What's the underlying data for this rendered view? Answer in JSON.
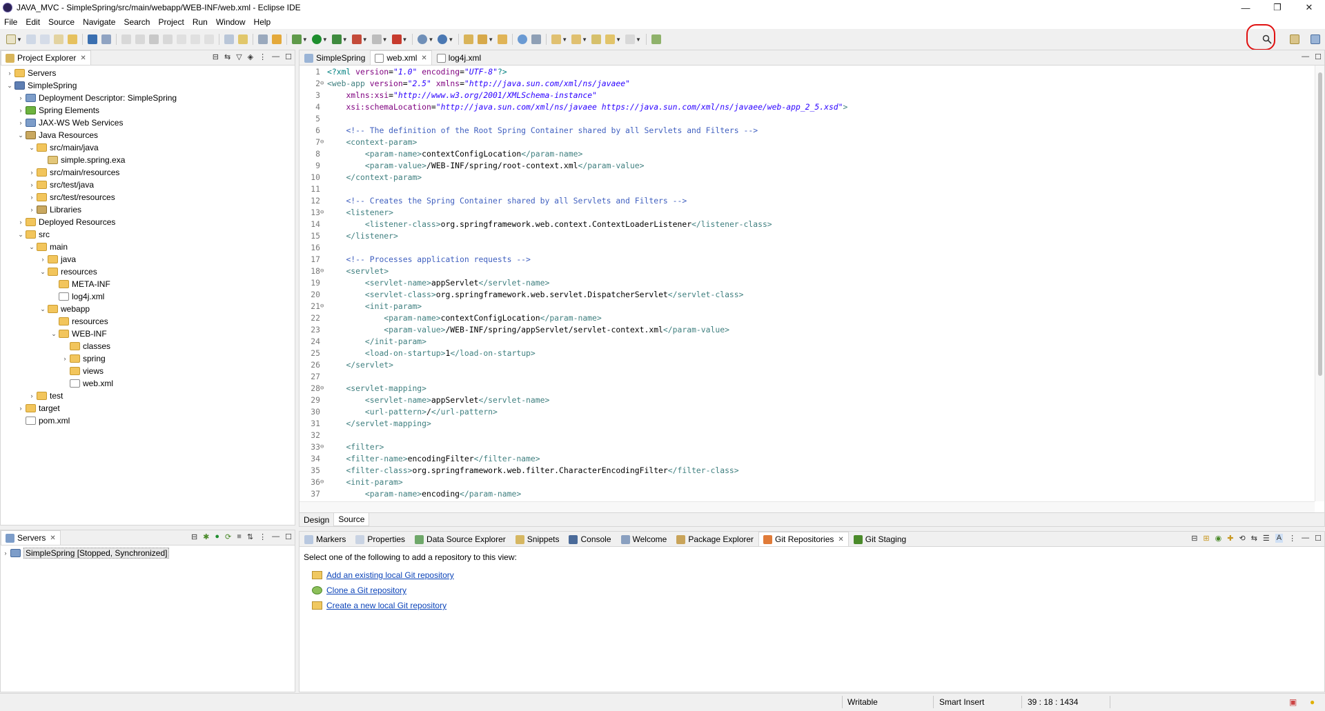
{
  "window": {
    "title": "JAVA_MVC - SimpleSpring/src/main/webapp/WEB-INF/web.xml - Eclipse IDE"
  },
  "menu": [
    "File",
    "Edit",
    "Source",
    "Navigate",
    "Search",
    "Project",
    "Run",
    "Window",
    "Help"
  ],
  "project_explorer": {
    "title": "Project Explorer",
    "items": [
      {
        "label": "Servers",
        "depth": 0,
        "twisty": "closed",
        "icon": "folder-icon"
      },
      {
        "label": "SimpleSpring",
        "depth": 0,
        "twisty": "open",
        "icon": "project-icon"
      },
      {
        "label": "Deployment Descriptor: SimpleSpring",
        "depth": 1,
        "twisty": "closed",
        "icon": "descriptor-icon"
      },
      {
        "label": "Spring Elements",
        "depth": 1,
        "twisty": "closed",
        "icon": "spring-icon"
      },
      {
        "label": "JAX-WS Web Services",
        "depth": 1,
        "twisty": "closed",
        "icon": "webservice-icon"
      },
      {
        "label": "Java Resources",
        "depth": 1,
        "twisty": "open",
        "icon": "java-resources-icon"
      },
      {
        "label": "src/main/java",
        "depth": 2,
        "twisty": "open",
        "icon": "source-folder-icon"
      },
      {
        "label": "simple.spring.exa",
        "depth": 3,
        "twisty": "none",
        "icon": "package-icon"
      },
      {
        "label": "src/main/resources",
        "depth": 2,
        "twisty": "closed",
        "icon": "source-folder-icon"
      },
      {
        "label": "src/test/java",
        "depth": 2,
        "twisty": "closed",
        "icon": "source-folder-icon"
      },
      {
        "label": "src/test/resources",
        "depth": 2,
        "twisty": "closed",
        "icon": "source-folder-icon"
      },
      {
        "label": "Libraries",
        "depth": 2,
        "twisty": "closed",
        "icon": "library-icon"
      },
      {
        "label": "Deployed Resources",
        "depth": 1,
        "twisty": "closed",
        "icon": "folder-icon"
      },
      {
        "label": "src",
        "depth": 1,
        "twisty": "open",
        "icon": "folder-icon"
      },
      {
        "label": "main",
        "depth": 2,
        "twisty": "open",
        "icon": "folder-icon"
      },
      {
        "label": "java",
        "depth": 3,
        "twisty": "closed",
        "icon": "folder-icon"
      },
      {
        "label": "resources",
        "depth": 3,
        "twisty": "open",
        "icon": "folder-icon"
      },
      {
        "label": "META-INF",
        "depth": 4,
        "twisty": "none",
        "icon": "folder-icon"
      },
      {
        "label": "log4j.xml",
        "depth": 4,
        "twisty": "none",
        "icon": "xml-file-icon"
      },
      {
        "label": "webapp",
        "depth": 3,
        "twisty": "open",
        "icon": "folder-icon"
      },
      {
        "label": "resources",
        "depth": 4,
        "twisty": "none",
        "icon": "folder-icon"
      },
      {
        "label": "WEB-INF",
        "depth": 4,
        "twisty": "open",
        "icon": "folder-icon"
      },
      {
        "label": "classes",
        "depth": 5,
        "twisty": "none",
        "icon": "folder-icon"
      },
      {
        "label": "spring",
        "depth": 5,
        "twisty": "closed",
        "icon": "folder-icon"
      },
      {
        "label": "views",
        "depth": 5,
        "twisty": "none",
        "icon": "folder-icon"
      },
      {
        "label": "web.xml",
        "depth": 5,
        "twisty": "none",
        "icon": "xml-file-icon"
      },
      {
        "label": "test",
        "depth": 2,
        "twisty": "closed",
        "icon": "folder-icon"
      },
      {
        "label": "target",
        "depth": 1,
        "twisty": "closed",
        "icon": "folder-icon"
      },
      {
        "label": "pom.xml",
        "depth": 1,
        "twisty": "none",
        "icon": "xml-file-icon"
      }
    ]
  },
  "servers": {
    "title": "Servers",
    "items": [
      {
        "label": "SimpleSpring  [Stopped, Synchronized]"
      }
    ]
  },
  "editor": {
    "tabs": [
      "SimpleSpring",
      "web.xml",
      "log4j.xml"
    ],
    "active_tab": "web.xml",
    "bottom_tabs": [
      "Design",
      "Source"
    ],
    "lines": [
      {
        "n": "1",
        "fold": "",
        "html": "<span class='d'>&lt;?xml</span> <span class='a'>version</span>=<span class='v'>\"1.0\"</span> <span class='a'>encoding</span>=<span class='v'>\"UTF-8\"</span><span class='d'>?&gt;</span>"
      },
      {
        "n": "2",
        "fold": "⊖",
        "html": "<span class='t'>&lt;web-app</span> <span class='a'>version</span>=<span class='v'>\"2.5\"</span> <span class='a'>xmlns</span>=<span class='v'>\"http://java.sun.com/xml/ns/javaee\"</span>"
      },
      {
        "n": "3",
        "fold": "",
        "html": "    <span class='a'>xmlns:xsi</span>=<span class='v'>\"http://www.w3.org/2001/XMLSchema-instance\"</span>"
      },
      {
        "n": "4",
        "fold": "",
        "html": "    <span class='a'>xsi:schemaLocation</span>=<span class='v'>\"http://java.sun.com/xml/ns/javaee https://java.sun.com/xml/ns/javaee/web-app_2_5.xsd\"</span><span class='t'>&gt;</span>"
      },
      {
        "n": "5",
        "fold": "",
        "html": ""
      },
      {
        "n": "6",
        "fold": "",
        "html": "    <span class='c'>&lt;!-- The definition of the Root Spring Container shared by all Servlets and Filters --&gt;</span>"
      },
      {
        "n": "7",
        "fold": "⊖",
        "html": "    <span class='t'>&lt;context-param&gt;</span>"
      },
      {
        "n": "8",
        "fold": "",
        "html": "        <span class='t'>&lt;param-name&gt;</span>contextConfigLocation<span class='t'>&lt;/param-name&gt;</span>"
      },
      {
        "n": "9",
        "fold": "",
        "html": "        <span class='t'>&lt;param-value&gt;</span>/WEB-INF/spring/root-context.xml<span class='t'>&lt;/param-value&gt;</span>"
      },
      {
        "n": "10",
        "fold": "",
        "html": "    <span class='t'>&lt;/context-param&gt;</span>"
      },
      {
        "n": "11",
        "fold": "",
        "html": ""
      },
      {
        "n": "12",
        "fold": "",
        "html": "    <span class='c'>&lt;!-- Creates the Spring Container shared by all Servlets and Filters --&gt;</span>"
      },
      {
        "n": "13",
        "fold": "⊖",
        "html": "    <span class='t'>&lt;listener&gt;</span>"
      },
      {
        "n": "14",
        "fold": "",
        "html": "        <span class='t'>&lt;listener-class&gt;</span>org.springframework.web.context.ContextLoaderListener<span class='t'>&lt;/listener-class&gt;</span>"
      },
      {
        "n": "15",
        "fold": "",
        "html": "    <span class='t'>&lt;/listener&gt;</span>"
      },
      {
        "n": "16",
        "fold": "",
        "html": ""
      },
      {
        "n": "17",
        "fold": "",
        "html": "    <span class='c'>&lt;!-- Processes application requests --&gt;</span>"
      },
      {
        "n": "18",
        "fold": "⊖",
        "html": "    <span class='t'>&lt;servlet&gt;</span>"
      },
      {
        "n": "19",
        "fold": "",
        "html": "        <span class='t'>&lt;servlet-name&gt;</span>appServlet<span class='t'>&lt;/servlet-name&gt;</span>"
      },
      {
        "n": "20",
        "fold": "",
        "html": "        <span class='t'>&lt;servlet-class&gt;</span>org.springframework.web.servlet.DispatcherServlet<span class='t'>&lt;/servlet-class&gt;</span>"
      },
      {
        "n": "21",
        "fold": "⊖",
        "html": "        <span class='t'>&lt;init-param&gt;</span>"
      },
      {
        "n": "22",
        "fold": "",
        "html": "            <span class='t'>&lt;param-name&gt;</span>contextConfigLocation<span class='t'>&lt;/param-name&gt;</span>"
      },
      {
        "n": "23",
        "fold": "",
        "html": "            <span class='t'>&lt;param-value&gt;</span>/WEB-INF/spring/appServlet/servlet-context.xml<span class='t'>&lt;/param-value&gt;</span>"
      },
      {
        "n": "24",
        "fold": "",
        "html": "        <span class='t'>&lt;/init-param&gt;</span>"
      },
      {
        "n": "25",
        "fold": "",
        "html": "        <span class='t'>&lt;load-on-startup&gt;</span>1<span class='t'>&lt;/load-on-startup&gt;</span>"
      },
      {
        "n": "26",
        "fold": "",
        "html": "    <span class='t'>&lt;/servlet&gt;</span>"
      },
      {
        "n": "27",
        "fold": "",
        "html": ""
      },
      {
        "n": "28",
        "fold": "⊖",
        "html": "    <span class='t'>&lt;servlet-mapping&gt;</span>"
      },
      {
        "n": "29",
        "fold": "",
        "html": "        <span class='t'>&lt;servlet-name&gt;</span>appServlet<span class='t'>&lt;/servlet-name&gt;</span>"
      },
      {
        "n": "30",
        "fold": "",
        "html": "        <span class='t'>&lt;url-pattern&gt;</span>/<span class='t'>&lt;/url-pattern&gt;</span>"
      },
      {
        "n": "31",
        "fold": "",
        "html": "    <span class='t'>&lt;/servlet-mapping&gt;</span>"
      },
      {
        "n": "32",
        "fold": "",
        "html": ""
      },
      {
        "n": "33",
        "fold": "⊖",
        "html": "    <span class='t'>&lt;filter&gt;</span>"
      },
      {
        "n": "34",
        "fold": "",
        "html": "    <span class='t'>&lt;filter-name&gt;</span>encodingFilter<span class='t'>&lt;/filter-name&gt;</span>"
      },
      {
        "n": "35",
        "fold": "",
        "html": "    <span class='t'>&lt;filter-class&gt;</span>org.springframework.web.filter.CharacterEncodingFilter<span class='t'>&lt;/filter-class&gt;</span>"
      },
      {
        "n": "36",
        "fold": "⊖",
        "html": "    <span class='t'>&lt;init-param&gt;</span>"
      },
      {
        "n": "37",
        "fold": "",
        "html": "        <span class='t'>&lt;param-name&gt;</span>encoding<span class='t'>&lt;/param-name&gt;</span>"
      }
    ]
  },
  "bottom_panel": {
    "tabs": [
      "Markers",
      "Properties",
      "Data Source Explorer",
      "Snippets",
      "Console",
      "Welcome",
      "Package Explorer",
      "Git Repositories",
      "Git Staging"
    ],
    "active_tab": "Git Repositories",
    "intro": "Select one of the following to add a repository to this view:",
    "links": [
      "Add an existing local Git repository",
      "Clone a Git repository",
      "Create a new local Git repository"
    ]
  },
  "status": {
    "writable": "Writable",
    "insert_mode": "Smart Insert",
    "position": "39 : 18 : 1434"
  },
  "colors": {
    "annotation_red": "#e01010",
    "link_blue": "#0b43b8"
  }
}
